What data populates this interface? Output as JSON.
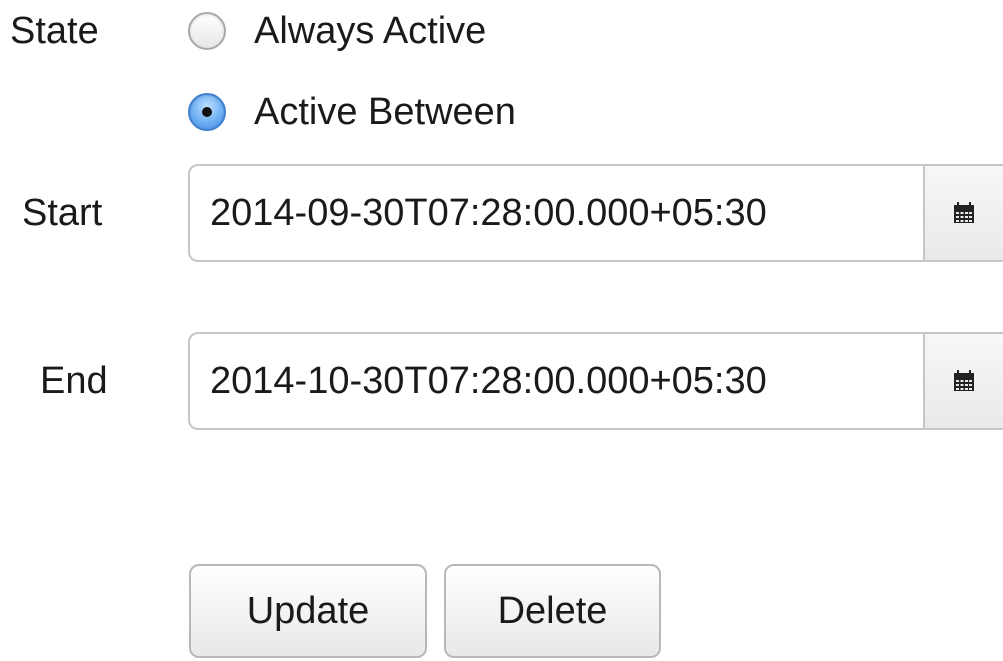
{
  "form": {
    "state_label": "State",
    "state_options": [
      {
        "label": "Always Active",
        "selected": false
      },
      {
        "label": "Active Between",
        "selected": true
      }
    ],
    "start_label": "Start",
    "start_value": "2014-09-30T07:28:00.000+05:30",
    "end_label": "End",
    "end_value": "2014-10-30T07:28:00.000+05:30",
    "calendar_icon": "calendar-icon"
  },
  "actions": {
    "update_label": "Update",
    "delete_label": "Delete"
  }
}
